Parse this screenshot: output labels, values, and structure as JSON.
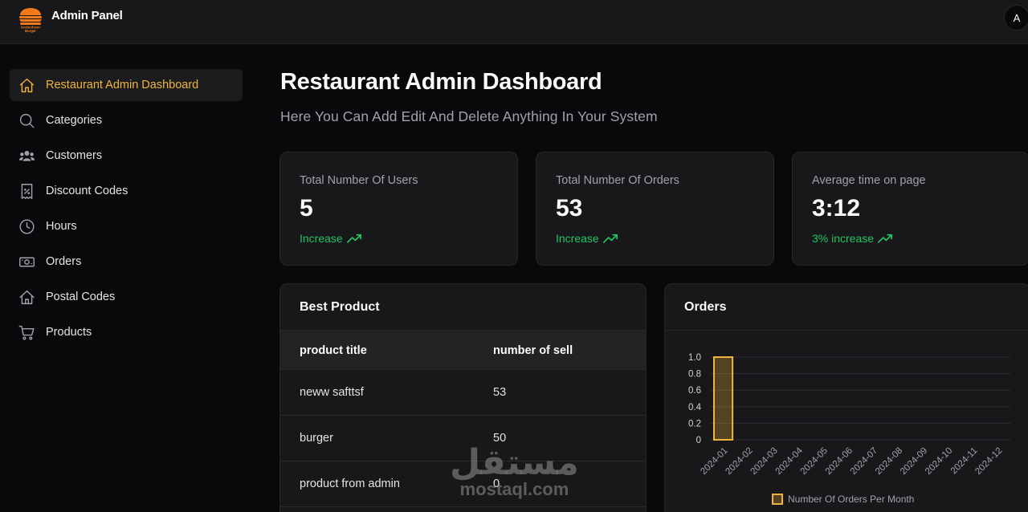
{
  "header": {
    "brand": "Admin Panel",
    "logo_text_top": "Andochoor",
    "logo_text_bottom": "Burger",
    "avatar_initial": "A"
  },
  "sidebar": {
    "items": [
      {
        "label": "Restaurant Admin Dashboard",
        "icon": "home-icon",
        "active": true
      },
      {
        "label": "Categories",
        "icon": "search-icon",
        "active": false
      },
      {
        "label": "Customers",
        "icon": "users-icon",
        "active": false
      },
      {
        "label": "Discount Codes",
        "icon": "receipt-percent-icon",
        "active": false
      },
      {
        "label": "Hours",
        "icon": "clock-icon",
        "active": false
      },
      {
        "label": "Orders",
        "icon": "banknote-icon",
        "active": false
      },
      {
        "label": "Postal Codes",
        "icon": "house-icon",
        "active": false
      },
      {
        "label": "Products",
        "icon": "cart-icon",
        "active": false
      }
    ]
  },
  "main": {
    "title": "Restaurant Admin Dashboard",
    "subtitle": "Here You Can Add Edit And Delete Anything In Your System"
  },
  "stats": [
    {
      "label": "Total Number Of Users",
      "value": "5",
      "trend": "Increase"
    },
    {
      "label": "Total Number Of Orders",
      "value": "53",
      "trend": "Increase"
    },
    {
      "label": "Average time on page",
      "value": "3:12",
      "trend": "3% increase"
    }
  ],
  "best_product": {
    "title": "Best Product",
    "columns": [
      "product title",
      "number of sell"
    ],
    "rows": [
      [
        "neww safttsf",
        "53"
      ],
      [
        "burger",
        "50"
      ],
      [
        "product from admin",
        "0"
      ]
    ]
  },
  "orders_card": {
    "title": "Orders"
  },
  "chart_data": {
    "type": "bar",
    "categories": [
      "2024-01",
      "2024-02",
      "2024-03",
      "2024-04",
      "2024-05",
      "2024-06",
      "2024-07",
      "2024-08",
      "2024-09",
      "2024-10",
      "2024-11",
      "2024-12"
    ],
    "series": [
      {
        "name": "Number Of Orders Per Month",
        "values": [
          1,
          0,
          0,
          0,
          0,
          0,
          0,
          0,
          0,
          0,
          0,
          0
        ]
      }
    ],
    "yticks": [
      "0",
      "0.2",
      "0.4",
      "0.6",
      "0.8",
      "1.0"
    ],
    "ylim": [
      0,
      1
    ],
    "title": "",
    "xlabel": "",
    "ylabel": "",
    "legend": "bottom",
    "grid": true,
    "bar_color": "#f0b43a"
  },
  "watermark": {
    "arabic": "مستقل",
    "latin": "mostaql.com"
  },
  "colors": {
    "accent": "#f0b43a",
    "positive": "#22c55e",
    "background": "#09090b",
    "card": "#18181b"
  }
}
